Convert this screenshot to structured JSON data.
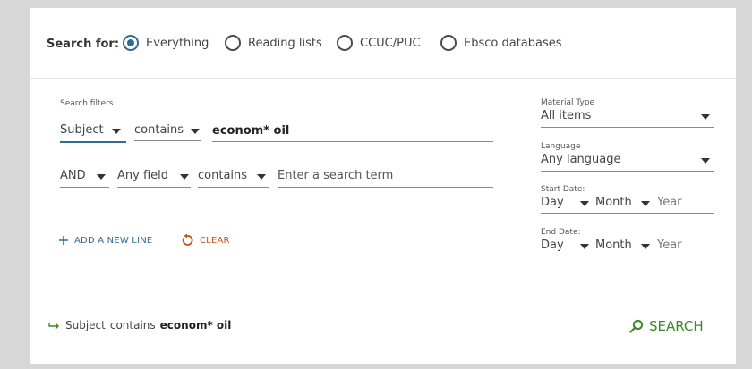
{
  "scope": {
    "label": "Search for:",
    "options": [
      {
        "label": "Everything",
        "checked": true
      },
      {
        "label": "Reading lists",
        "checked": false
      },
      {
        "label": "CCUC/PUC",
        "checked": false
      },
      {
        "label": "Ebsco databases",
        "checked": false
      }
    ]
  },
  "filters": {
    "heading": "Search filters",
    "line1": {
      "field": "Subject",
      "operator": "contains",
      "value": "econom* oil"
    },
    "line2": {
      "boolean": "AND",
      "field": "Any field",
      "operator": "contains",
      "placeholder": "Enter a search term"
    },
    "add_line": "ADD A NEW LINE",
    "clear": "CLEAR"
  },
  "side": {
    "material_type": {
      "label": "Material Type",
      "value": "All items"
    },
    "language": {
      "label": "Language",
      "value": "Any language"
    },
    "start_date": {
      "label": "Start Date:",
      "day": "Day",
      "month": "Month",
      "year": "Year"
    },
    "end_date": {
      "label": "End Date:",
      "day": "Day",
      "month": "Month",
      "year": "Year"
    }
  },
  "summary": {
    "field": "Subject",
    "operator": "contains",
    "value": "econom* oil"
  },
  "search_button": "SEARCH",
  "colors": {
    "accent": "#2f6b99",
    "clear": "#c0561a",
    "search": "#3a8a2a"
  }
}
